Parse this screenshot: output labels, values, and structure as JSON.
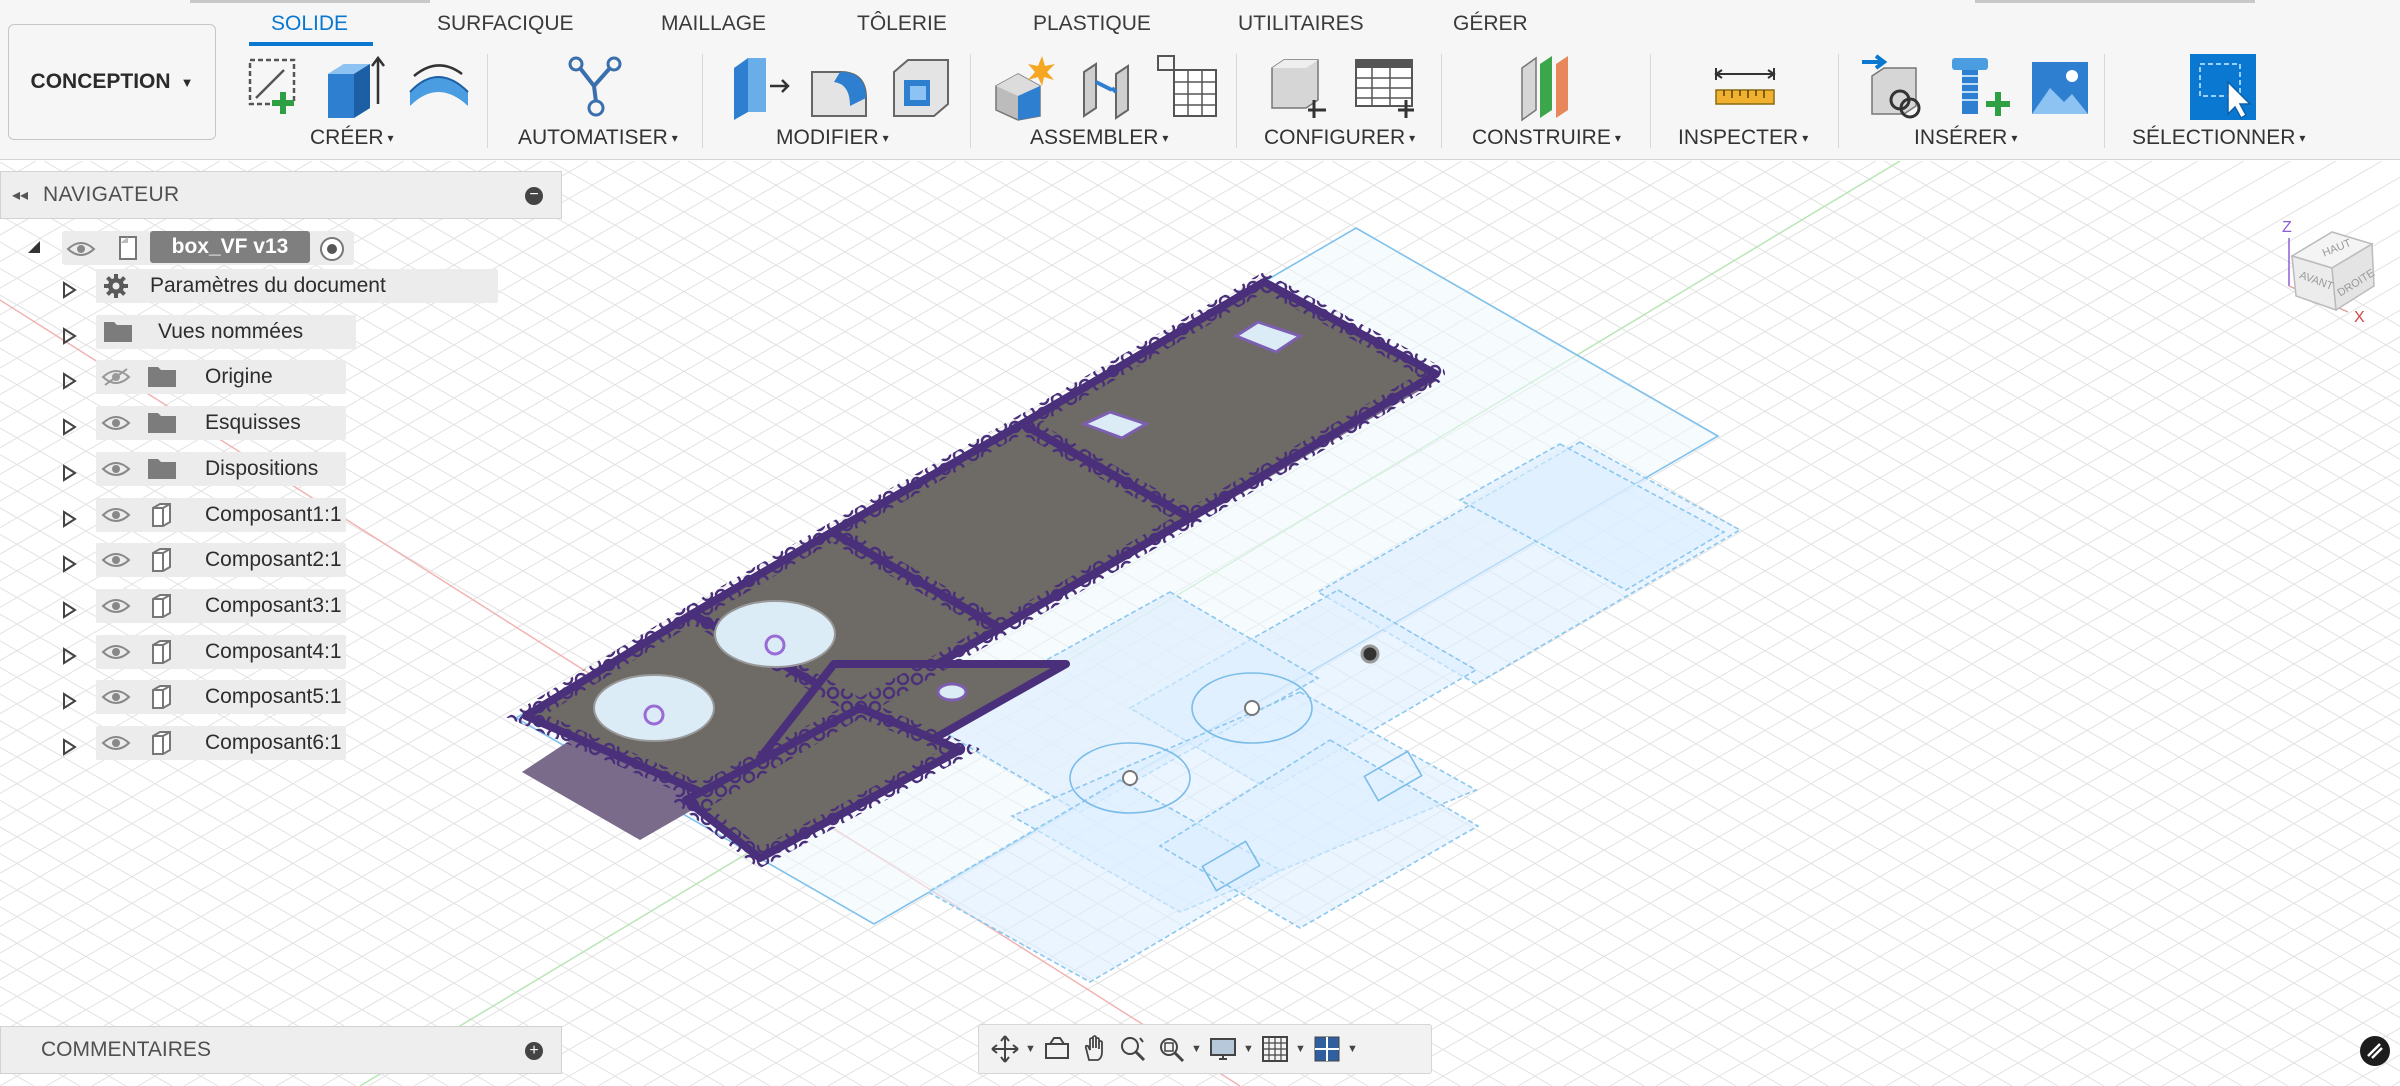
{
  "toolbar": {
    "workspace": {
      "label": "CONCEPTION",
      "caret": "▼"
    },
    "tabs": [
      {
        "label": "SOLIDE",
        "active": true
      },
      {
        "label": "SURFACIQUE"
      },
      {
        "label": "MAILLAGE"
      },
      {
        "label": "TÔLERIE"
      },
      {
        "label": "PLASTIQUE"
      },
      {
        "label": "UTILITAIRES"
      },
      {
        "label": "GÉRER"
      }
    ],
    "groups": [
      {
        "label": "CRÉER",
        "caret": "▾"
      },
      {
        "label": "AUTOMATISER",
        "caret": "▾"
      },
      {
        "label": "MODIFIER",
        "caret": "▾"
      },
      {
        "label": "ASSEMBLER",
        "caret": "▾"
      },
      {
        "label": "CONFIGURER",
        "caret": "▾"
      },
      {
        "label": "CONSTRUIRE",
        "caret": "▾"
      },
      {
        "label": "INSPECTER",
        "caret": "▾"
      },
      {
        "label": "INSÉRER",
        "caret": "▾"
      },
      {
        "label": "SÉLECTIONNER",
        "caret": "▾"
      }
    ],
    "tools": [
      "create-sketch-icon",
      "extrude-icon",
      "revolve-icon",
      "automate-icon",
      "press-pull-icon",
      "fillet-icon",
      "shell-icon",
      "new-component-icon",
      "joint-icon",
      "component-table-icon",
      "configure-icon",
      "configuration-table-icon",
      "construct-plane-icon",
      "measure-icon",
      "insert-derive-icon",
      "insert-fastener-icon",
      "insert-image-icon",
      "select-icon"
    ]
  },
  "navigator": {
    "title": "NAVIGATEUR",
    "root": {
      "name": "box_VF v13"
    },
    "items": [
      {
        "label": "Paramètres du document",
        "icon": "gear-icon",
        "visible": null
      },
      {
        "label": "Vues nommées",
        "icon": "folder-icon",
        "visible": null
      },
      {
        "label": "Origine",
        "icon": "folder-icon",
        "visible": false
      },
      {
        "label": "Esquisses",
        "icon": "folder-icon",
        "visible": true
      },
      {
        "label": "Dispositions",
        "icon": "folder-icon",
        "visible": true
      },
      {
        "label": "Composant1:1",
        "icon": "component-icon",
        "visible": true
      },
      {
        "label": "Composant2:1",
        "icon": "component-icon",
        "visible": true
      },
      {
        "label": "Composant3:1",
        "icon": "component-icon",
        "visible": true
      },
      {
        "label": "Composant4:1",
        "icon": "component-icon",
        "visible": true
      },
      {
        "label": "Composant5:1",
        "icon": "component-icon",
        "visible": true
      },
      {
        "label": "Composant6:1",
        "icon": "component-icon",
        "visible": true
      }
    ]
  },
  "comments": {
    "title": "COMMENTAIRES"
  },
  "viewcube": {
    "axes": {
      "z": "Z",
      "x": "X"
    },
    "faces": {
      "top": "HAUT",
      "front": "AVANT",
      "right": "DROITE"
    }
  },
  "navbar": {
    "tools": [
      "orbit-icon",
      "look-at-icon",
      "pan-icon",
      "zoom-icon",
      "fit-icon",
      "display-settings-icon",
      "grid-settings-icon",
      "viewports-icon"
    ]
  },
  "colors": {
    "accent": "#0a78d0",
    "plate": "#6f6b66",
    "plate_edge": "#5b3f8c",
    "sketch": "#4aa3df",
    "sketch_fill": "#dbeefa",
    "grid": "#dedede"
  }
}
